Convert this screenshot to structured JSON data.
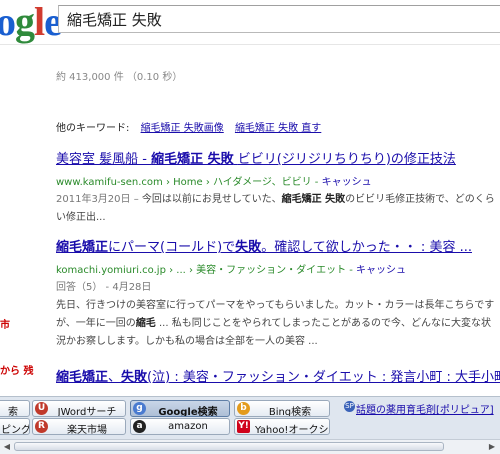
{
  "header": {
    "logo_text": "Google",
    "query": "縮毛矯正 失敗"
  },
  "stats": "約 413,000 件 （0.10 秒）",
  "related": {
    "label": "他のキーワード:",
    "links": [
      "縮毛矯正 失敗画像",
      "縮毛矯正 失敗 直す"
    ]
  },
  "results": [
    {
      "title_pre": "美容室 髪風船 - ",
      "title_bold": "縮毛矯正 失敗",
      "title_post": "ビビリ(ジリジリちりちり)の修正技法",
      "url": "www.kamifu-sen.com › Home › ハイダメージ、ビビリ - ",
      "cache": "キャッシュ",
      "snippet_date": "2011年3月20日 – ",
      "snippet_a": "今回は以前にお見せしていた、",
      "snippet_b": "縮毛矯正 失敗",
      "snippet_c": "のビビリ毛修正技術で、どのくらい修正出..."
    },
    {
      "title_pre": "",
      "title_bold": "縮毛矯正",
      "title_mid": "にパーマ(コールド)で",
      "title_bold2": "失敗",
      "title_post": "。確認して欲しかった・・ : 美容 ...",
      "url": "komachi.yomiuri.co.jp › ... › 美容・ファッション・ダイエット - ",
      "cache": "キャッシュ",
      "meta": "回答（5） - 4月28日",
      "snippet_a": "先日、行きつけの美容室に行ってパーマをやってもらいました。カット・カラーは長年こちらですが、一年に一回の",
      "snippet_b": "縮毛",
      "snippet_c": " ... 私も同じことをやられてしまったことがあるので今、どんなに大変な状況かお察しします。しかも私の場合は全部を一人の美容 ..."
    },
    {
      "title_bold": "縮毛矯正",
      "title_mid": "、",
      "title_bold2": "失敗",
      "title_post": "(泣) : 美容・ファッション・ダイエット : 発言小町 : 大手小町 ..."
    }
  ],
  "left_edge": [
    "市",
    "から 残"
  ],
  "taskbar": {
    "row1": [
      {
        "label": "索",
        "icon": ""
      },
      {
        "label": "JWordサーチ",
        "icon": "U"
      },
      {
        "label": "Google検索",
        "icon": "g",
        "active": true
      },
      {
        "label": "Bing検索",
        "icon": "b"
      }
    ],
    "row2": [
      {
        "label": "ピング",
        "icon": ""
      },
      {
        "label": "楽天市場",
        "icon": "R"
      },
      {
        "label": "amazon",
        "icon": "a"
      },
      {
        "label": "Yahoo!オークション",
        "icon": "Y!"
      }
    ],
    "news": "話題の薬用育毛剤[ポリピュア]"
  },
  "colors": {
    "link": "#1a0dab",
    "url_green": "#2a8a2a",
    "taskbar_bg": "#dfe6ef"
  }
}
